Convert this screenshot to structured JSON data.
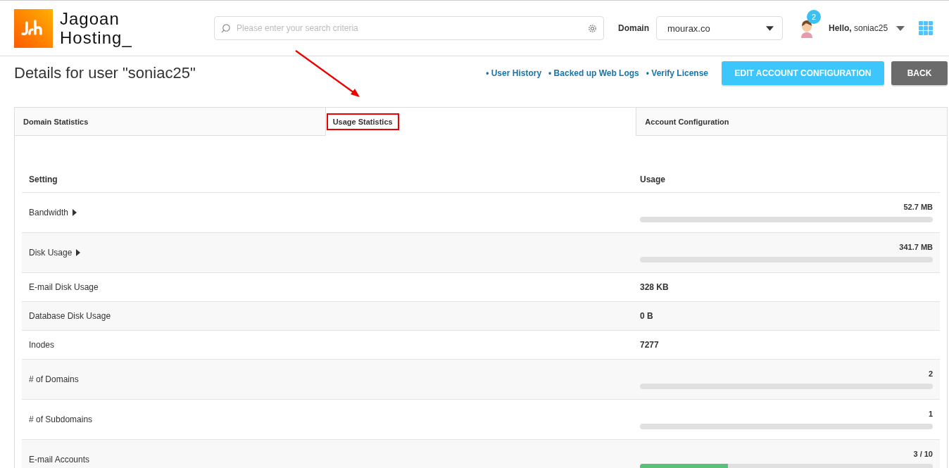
{
  "header": {
    "logo": {
      "line1": "Jagoan",
      "line2": "Hosting_"
    },
    "search": {
      "placeholder": "Please enter your search criteria"
    },
    "domain": {
      "label": "Domain",
      "value": "mourax.co"
    },
    "notifications": {
      "count": "2"
    },
    "greeting": {
      "hello": "Hello,",
      "user": "soniac25"
    }
  },
  "title": "Details for user \"soniac25\"",
  "links": [
    {
      "label": "• User History"
    },
    {
      "label": "• Backed up Web Logs"
    },
    {
      "label": "• Verify License"
    }
  ],
  "buttons": [
    {
      "label": "EDIT ACCOUNT CONFIGURATION",
      "kind": "primary"
    },
    {
      "label": "BACK",
      "kind": "secondary"
    }
  ],
  "tabs": [
    {
      "label": "Domain Statistics",
      "selected": false,
      "highlighted": false
    },
    {
      "label": "Usage Statistics",
      "selected": true,
      "highlighted": true
    },
    {
      "label": "Account Configuration",
      "selected": false,
      "highlighted": false
    }
  ],
  "table": {
    "columns": [
      "Setting",
      "Usage"
    ],
    "rows": [
      {
        "setting": "Bandwidth",
        "expandable": true,
        "kind": "bar",
        "usage": "52.7 MB"
      },
      {
        "setting": "Disk Usage",
        "expandable": true,
        "kind": "bar",
        "usage": "341.7 MB"
      },
      {
        "setting": "E-mail Disk Usage",
        "expandable": false,
        "kind": "plain",
        "usage": "328 KB"
      },
      {
        "setting": "Database Disk Usage",
        "expandable": false,
        "kind": "plain",
        "usage": "0 B"
      },
      {
        "setting": "Inodes",
        "expandable": false,
        "kind": "plain",
        "usage": "7277"
      },
      {
        "setting": "# of Domains",
        "expandable": false,
        "kind": "bar",
        "usage": "2"
      },
      {
        "setting": "# of Subdomains",
        "expandable": false,
        "kind": "bar",
        "usage": "1"
      },
      {
        "setting": "E-mail Accounts",
        "expandable": false,
        "kind": "bar",
        "usage": "3 / 10",
        "level": 0.3
      }
    ]
  }
}
